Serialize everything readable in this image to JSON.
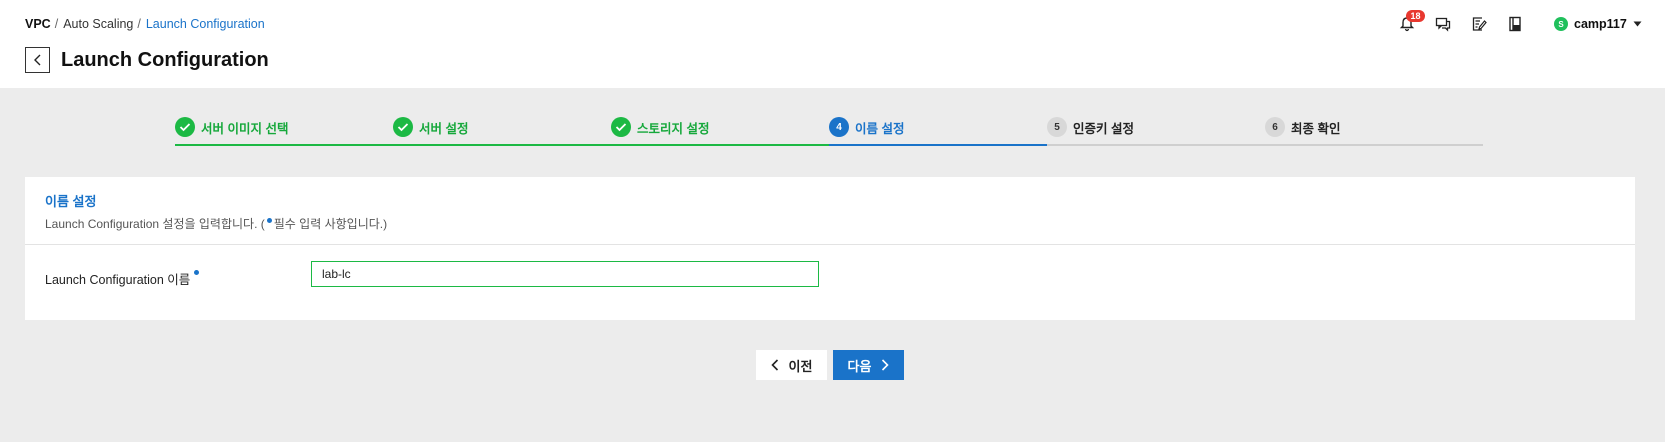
{
  "breadcrumb": {
    "root": "VPC",
    "middle": "Auto Scaling",
    "current": "Launch Configuration"
  },
  "page": {
    "title": "Launch Configuration"
  },
  "top_bar": {
    "notification_count": "18",
    "icons": [
      "bell-icon",
      "chat-icon",
      "edit-note-icon",
      "book-icon"
    ],
    "user_initial": "S",
    "user_name": "camp117"
  },
  "steps": [
    {
      "number": "1",
      "label": "서버 이미지 선택",
      "state": "done"
    },
    {
      "number": "2",
      "label": "서버 설정",
      "state": "done"
    },
    {
      "number": "3",
      "label": "스토리지 설정",
      "state": "done"
    },
    {
      "number": "4",
      "label": "이름 설정",
      "state": "active"
    },
    {
      "number": "5",
      "label": "인증키 설정",
      "state": "pending"
    },
    {
      "number": "6",
      "label": "최종 확인",
      "state": "pending"
    }
  ],
  "panel": {
    "title": "이름 설정",
    "desc_before": "Launch Configuration 설정을 입력합니다. (",
    "desc_after": "필수 입력 사항입니다.)",
    "field_label": "Launch Configuration 이름",
    "field_value": "lab-lc"
  },
  "buttons": {
    "prev": "이전",
    "next": "다음"
  },
  "colors": {
    "accent": "#1a73c9",
    "success": "#1cb944",
    "badge": "#e8382f",
    "background": "#ececec"
  }
}
